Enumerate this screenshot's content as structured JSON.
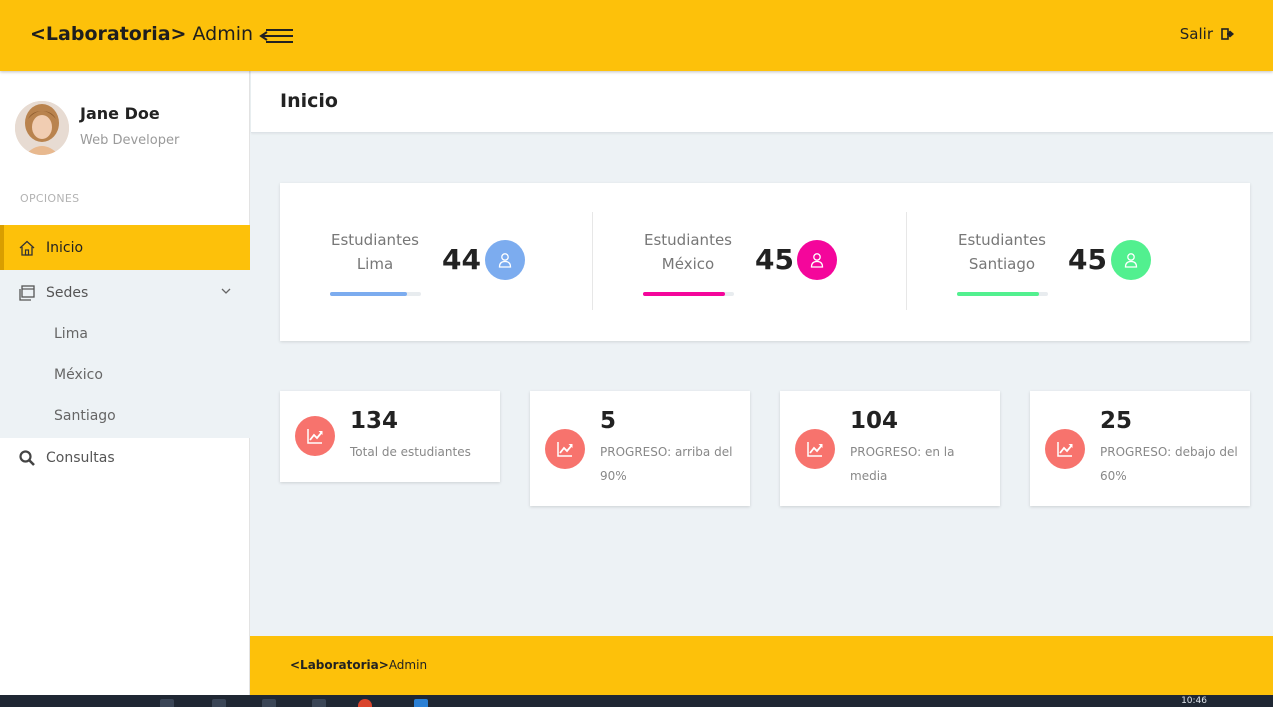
{
  "header": {
    "brand_bold": "<Laboratoria>",
    "brand_light": " Admin",
    "logout_label": "Salir"
  },
  "sidebar": {
    "user_name": "Jane Doe",
    "user_role": "Web Developer",
    "section_label": "OPCIONES",
    "items": [
      {
        "label": "Inicio",
        "icon": "home-icon"
      },
      {
        "label": "Sedes",
        "icon": "pages-icon"
      },
      {
        "label": "Consultas",
        "icon": "search-icon"
      }
    ],
    "sub_items": [
      "Lima",
      "México",
      "Santiago"
    ]
  },
  "page": {
    "title": "Inicio"
  },
  "stats": [
    {
      "label_1": "Estudiantes",
      "label_2": "Lima",
      "value": "44",
      "color": "#7cacef",
      "progress": 0.85
    },
    {
      "label_1": "Estudiantes",
      "label_2": "México",
      "value": "45",
      "color": "#f4069b",
      "progress": 0.9
    },
    {
      "label_1": "Estudiantes",
      "label_2": "Santiago",
      "value": "45",
      "color": "#52f08f",
      "progress": 0.9
    }
  ],
  "cards": [
    {
      "value": "134",
      "desc": "Total de estudiantes",
      "icon": "trending-up-icon"
    },
    {
      "value": "5",
      "desc": "PROGRESO: arriba del 90%",
      "icon": "trending-up-icon"
    },
    {
      "value": "104",
      "desc": "PROGRESO: en la media",
      "icon": "trending-up-icon"
    },
    {
      "value": "25",
      "desc": "PROGRESO: debajo del 60%",
      "icon": "trending-up-icon"
    }
  ],
  "footer": {
    "brand_bold": "<Laboratoria>",
    "brand_light": "Admin"
  },
  "taskbar": {
    "clock": "10:46"
  },
  "colors": {
    "accent": "#fdc10a",
    "card_icon": "#f7736d",
    "background": "#edf2f5"
  }
}
